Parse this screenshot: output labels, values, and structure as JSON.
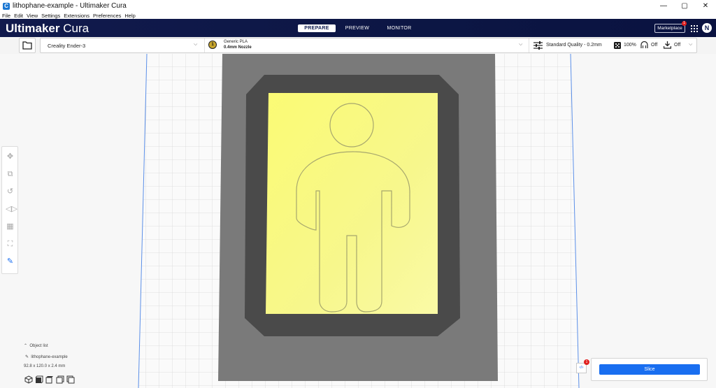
{
  "window": {
    "title": "lithophane-example - Ultimaker Cura",
    "controls": {
      "minimize": "—",
      "maximize": "▢",
      "close": "✕"
    }
  },
  "menu": [
    "File",
    "Edit",
    "View",
    "Settings",
    "Extensions",
    "Preferences",
    "Help"
  ],
  "header": {
    "brand_bold": "Ultimaker",
    "brand_light": " Cura",
    "stages": [
      "PREPARE",
      "PREVIEW",
      "MONITOR"
    ],
    "active_stage": "PREPARE",
    "marketplace_label": "Marketplace",
    "marketplace_badge": "1",
    "avatar_initial": "N"
  },
  "toolbar": {
    "printer": "Creality Ender-3",
    "extruder_number": "1",
    "material": "Generic PLA",
    "nozzle": "0.4mm Nozzle",
    "profile": "Standard Quality - 0.2mm",
    "infill": "100%",
    "support": "Off",
    "adhesion": "Off"
  },
  "object_list": {
    "header": "Object list",
    "item": "lithophane-example",
    "dimensions": "92.8 x 120.0 x 2.4 mm"
  },
  "slice": {
    "button_label": "Slice",
    "badge": "1"
  },
  "icons": [
    "folder-icon",
    "chevron-down-icon",
    "move-icon",
    "scale-icon",
    "rotate-icon",
    "mirror-icon",
    "per-model-settings-icon",
    "support-blocker-icon",
    "measure-icon",
    "grid-apps-icon",
    "view-3d-icon",
    "view-front-icon",
    "view-top-icon",
    "view-left-icon",
    "view-right-icon"
  ],
  "colors": {
    "header_bg": "#0e1a4f",
    "accent": "#196ef0",
    "lithophane": "#f6f56a",
    "print_area": "#7a7a7a",
    "frame": "#4a4a4a"
  }
}
